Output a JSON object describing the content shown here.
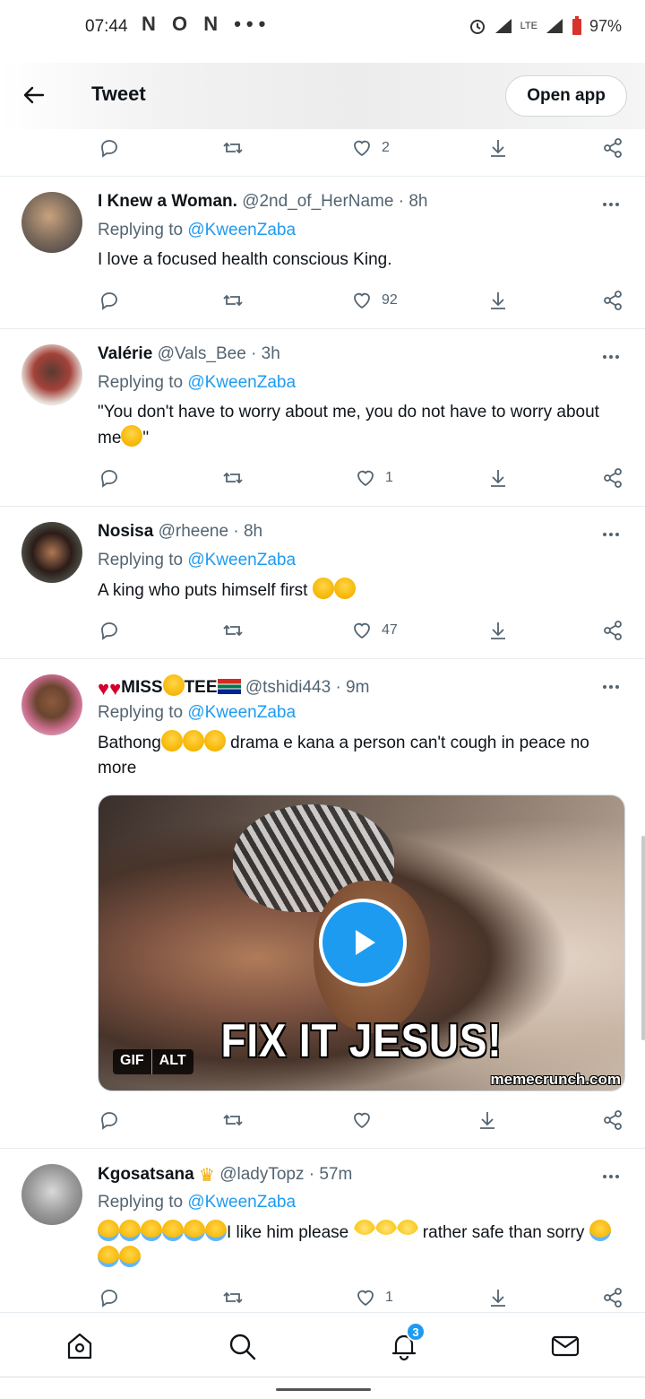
{
  "status_bar": {
    "time": "07:44",
    "left_icons": "N O N •••",
    "network": "LTE",
    "battery": "97%"
  },
  "header": {
    "title": "Tweet",
    "open_app": "Open app"
  },
  "top_actions": {
    "like_count": "2"
  },
  "tweets": [
    {
      "name": "I Knew a Woman.",
      "handle": "@2nd_of_HerName",
      "dot": "·",
      "time": "8h",
      "replying_prefix": "Replying to ",
      "replying_to": "@KweenZaba",
      "text": "I love a focused health conscious King.",
      "like_count": "92",
      "avatar_color": "#7b6a5b"
    },
    {
      "name": "Valérie",
      "handle": "@Vals_Bee",
      "dot": "·",
      "time": "3h",
      "replying_prefix": "Replying to ",
      "replying_to": "@KweenZaba",
      "text_a": "\"You don't have to worry about me, you do not have to worry about me",
      "text_b": "\"",
      "like_count": "1",
      "avatar_color": "#a3423a"
    },
    {
      "name": "Nosisa",
      "handle": "@rheene",
      "dot": "·",
      "time": "8h",
      "replying_prefix": "Replying to ",
      "replying_to": "@KweenZaba",
      "text": "A king who puts himself first ",
      "like_count": "47",
      "avatar_color": "#2b1c18"
    },
    {
      "name_a": "MISS",
      "name_b": "TEE",
      "handle": "@tshidi443",
      "dot": "·",
      "time": "9m",
      "replying_prefix": "Replying to ",
      "replying_to": "@KweenZaba",
      "text_a": "Bathong",
      "text_b": " drama e kana a person can't cough in peace no more",
      "media_caption": "FIX IT JESUS!",
      "media_watermark": "memecrunch.com",
      "gif_label": "GIF",
      "alt_label": "ALT",
      "like_count": "",
      "avatar_color": "#c76a8a"
    },
    {
      "name": "Kgosatsana",
      "handle": "@ladyTopz",
      "dot": "·",
      "time": "57m",
      "replying_prefix": "Replying to ",
      "replying_to": "@KweenZaba",
      "text_a": "I like him please ",
      "text_b": " rather safe than sorry ",
      "like_count": "1",
      "avatar_color": "#9a9a9a"
    }
  ],
  "bottom_nav": {
    "notifications_badge": "3"
  },
  "colors": {
    "accent": "#1d9bf0",
    "text": "#0f1419",
    "muted": "#536471"
  },
  "icons": [
    "back-arrow-icon",
    "reply-icon",
    "retweet-icon",
    "like-icon",
    "download-icon",
    "share-icon",
    "more-icon",
    "home-icon",
    "search-icon",
    "notifications-icon",
    "messages-icon",
    "play-icon"
  ]
}
